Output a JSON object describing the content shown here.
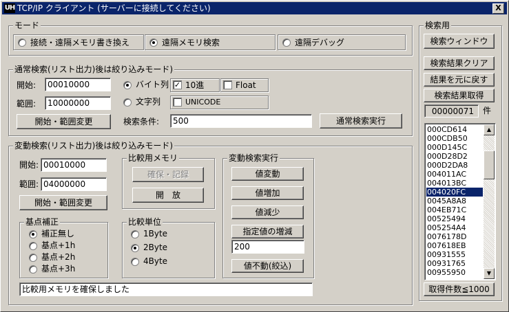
{
  "window": {
    "title": "TCP/IP クライアント (サーバーに接続してください)",
    "icon_text": "UH",
    "close_label": "X"
  },
  "mode": {
    "label": "モード",
    "options": [
      {
        "label": "接続・遠隔メモリ書き換え",
        "selected": false
      },
      {
        "label": "遠隔メモリ検索",
        "selected": true
      },
      {
        "label": "遠隔デバッグ",
        "selected": false
      }
    ]
  },
  "normal": {
    "label": "通常検索(リスト出力)後は絞り込みモード)",
    "start_label": "開始:",
    "start_value": "00010000",
    "range_label": "範囲:",
    "range_value": "10000000",
    "change_btn": "開始・範囲変更",
    "byte_label": "バイト列",
    "hex_label": "10進",
    "float_label": "Float",
    "string_label": "文字列",
    "unicode_label": "UNICODE",
    "cond_label": "検索条件:",
    "cond_value": "500",
    "exec_btn": "通常検索実行"
  },
  "variable": {
    "label": "変動検索(リスト出力)後は絞り込みモード)",
    "start_label": "開始:",
    "start_value": "00010000",
    "range_label": "範囲:",
    "range_value": "04000000",
    "change_btn": "開始・範囲変更",
    "memory": {
      "label": "比較用メモリ",
      "reserve_btn": "確保・記録",
      "release_btn": "開　放"
    },
    "exec": {
      "label": "変動検索実行",
      "btn_change": "値変動",
      "btn_inc": "値増加",
      "btn_dec": "値減少",
      "btn_delta": "指定値の増減",
      "delta_value": "200",
      "btn_same": "値不動(絞込)"
    },
    "base": {
      "label": "基点補正",
      "options": [
        "補正無し",
        "基点+1h",
        "基点+2h",
        "基点+3h"
      ]
    },
    "unit": {
      "label": "比較単位",
      "options": [
        "1Byte",
        "2Byte",
        "4Byte"
      ]
    },
    "status": "比較用メモリを確保しました"
  },
  "search_panel": {
    "label": "検索用",
    "btn_window": "検索ウィンドウ",
    "btn_clear": "検索結果クリア",
    "btn_restore": "結果を元に戻す",
    "btn_fetch": "検索結果取得",
    "count_value": "00000071",
    "count_unit": "件",
    "results": [
      "000CD614",
      "000CDB50",
      "000D145C",
      "000D28D2",
      "000D2DA8",
      "004011AC",
      "004013BC",
      "004020FC",
      "0045A8A8",
      "004EB71C",
      "00525494",
      "005254A4",
      "0076178D",
      "007618EB",
      "00931555",
      "00931765",
      "00955950"
    ],
    "selected_result": "004020FC",
    "limit_label": "取得件数≦1000"
  }
}
